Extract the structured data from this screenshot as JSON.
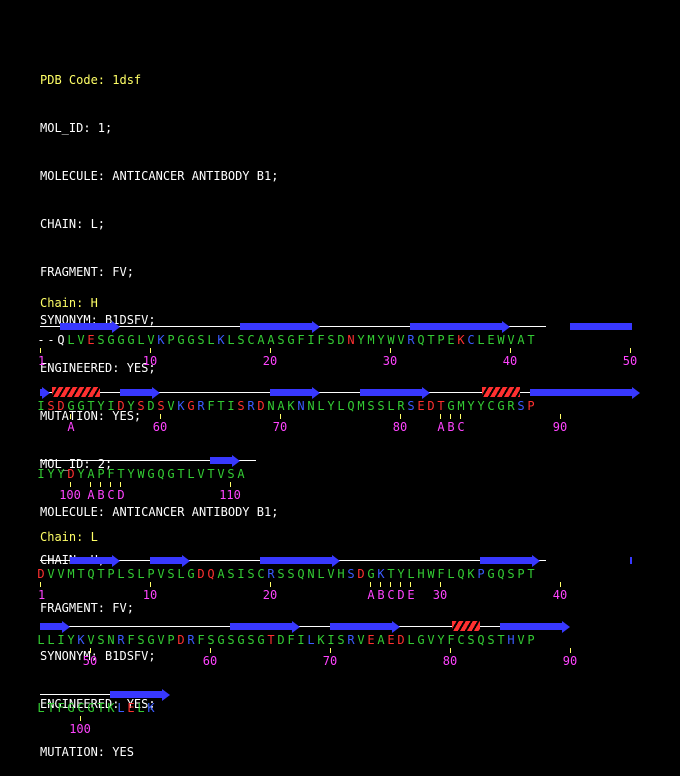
{
  "header": {
    "pdb_line": "PDB Code: 1dsf",
    "lines": [
      "MOL_ID: 1;",
      "MOLECULE: ANTICANCER ANTIBODY B1;",
      "CHAIN: L;",
      "FRAGMENT: FV;",
      "SYNONYM: B1DSFV;",
      "ENGINEERED: YES;",
      "MUTATION: YES;",
      "MOL_ID: 2;",
      "MOLECULE: ANTICANCER ANTIBODY B1;",
      "CHAIN: H;",
      "FRAGMENT: FV;",
      "SYNONYM: B1DSFV;",
      "ENGINEERED: YES;",
      "MUTATION: YES"
    ]
  },
  "chains": [
    {
      "label": "Chain: H",
      "rows": [
        {
          "seq": "--QLVESGGGLVKPGGSLKLSCAASGFIFSDNYMYWVRQTPEKCLEWVAT",
          "colors": "ww-ggrggggggbgggggbggggggggggggrgggggbggggrbggggggg",
          "numbers": [
            {
              "i": 0,
              "t": "1"
            },
            {
              "i": 11,
              "t": "10"
            },
            {
              "i": 23,
              "t": "20"
            },
            {
              "i": 35,
              "t": "30"
            },
            {
              "i": 47,
              "t": "40"
            },
            {
              "i": 59,
              "t": "50"
            }
          ],
          "ins": [],
          "strands": [
            [
              2,
              8
            ],
            [
              20,
              28
            ],
            [
              37,
              47
            ],
            [
              53,
              61
            ]
          ],
          "helices": []
        },
        {
          "seq": "ISDGGTYIDYSDSVKGRFTISRDNAKNNLYLQMSSLRSEDTGMYYCGRSP",
          "colors": "grrgggggrgrgrgbrbgggrbrgggbggggggggggbrrrgggggggbrg",
          "numbers": [
            {
              "i": 12,
              "t": "60"
            },
            {
              "i": 24,
              "t": "70"
            },
            {
              "i": 36,
              "t": "80"
            },
            {
              "i": 52,
              "t": "90"
            }
          ],
          "ins": [
            {
              "i": 3,
              "t": "A"
            },
            {
              "i": 40,
              "t": "A"
            },
            {
              "i": 41,
              "t": "B"
            },
            {
              "i": 42,
              "t": "C"
            }
          ],
          "strands": [
            [
              0,
              1
            ],
            [
              8,
              12
            ],
            [
              23,
              28
            ],
            [
              32,
              39
            ],
            [
              49,
              60
            ]
          ],
          "helices": [
            [
              1,
              6
            ],
            [
              44,
              48
            ]
          ]
        },
        {
          "seq": "IYYDYAPFTYWGQGTLVTVSA",
          "colors": "gggrggggggggggggggggg",
          "numbers": [
            {
              "i": 3,
              "t": "100"
            },
            {
              "i": 19,
              "t": "110"
            }
          ],
          "ins": [
            {
              "i": 5,
              "t": "A"
            },
            {
              "i": 6,
              "t": "B"
            },
            {
              "i": 7,
              "t": "C"
            },
            {
              "i": 8,
              "t": "D"
            }
          ],
          "strands": [
            [
              17,
              20
            ]
          ],
          "helices": []
        }
      ]
    },
    {
      "label": "Chain: L",
      "rows": [
        {
          "seq": "DVVMTQTPLSLPVSLGDQASISCRSSQNLVHSDGKTYLHWFLQKPGQSPT",
          "colors": "rgggggggggggggggrrgggggbgggggggbrgbgggggggggbggggggg",
          "numbers": [
            {
              "i": 0,
              "t": "1"
            },
            {
              "i": 11,
              "t": "10"
            },
            {
              "i": 23,
              "t": "20"
            },
            {
              "i": 40,
              "t": "30"
            },
            {
              "i": 52,
              "t": "40"
            }
          ],
          "ins": [
            {
              "i": 33,
              "t": "A"
            },
            {
              "i": 34,
              "t": "B"
            },
            {
              "i": 35,
              "t": "C"
            },
            {
              "i": 36,
              "t": "D"
            },
            {
              "i": 37,
              "t": "E"
            }
          ],
          "strands": [
            [
              3,
              8
            ],
            [
              11,
              15
            ],
            [
              22,
              30
            ],
            [
              44,
              50
            ],
            [
              59,
              61
            ]
          ],
          "helices": []
        },
        {
          "seq": "LLIYKVSNRFSGVPDRFSGSGSGTDFILKISRVEAEDLGVYFCSQSTHVP",
          "colors": "ggggbgggbgggggrbgggggggrgggbgggbgrgrrggggggggggbgg",
          "numbers": [
            {
              "i": 5,
              "t": "50"
            },
            {
              "i": 17,
              "t": "60"
            },
            {
              "i": 29,
              "t": "70"
            },
            {
              "i": 41,
              "t": "80"
            },
            {
              "i": 53,
              "t": "90"
            }
          ],
          "ins": [],
          "strands": [
            [
              0,
              3
            ],
            [
              19,
              26
            ],
            [
              29,
              36
            ],
            [
              46,
              53
            ]
          ],
          "helices": [
            [
              41,
              44
            ]
          ]
        },
        {
          "seq": "LTFGCGTKLELK",
          "colors": "ggggggggbrgb",
          "numbers": [
            {
              "i": 4,
              "t": "100"
            }
          ],
          "ins": [],
          "strands": [
            [
              7,
              13
            ]
          ],
          "helices": []
        }
      ]
    }
  ]
}
